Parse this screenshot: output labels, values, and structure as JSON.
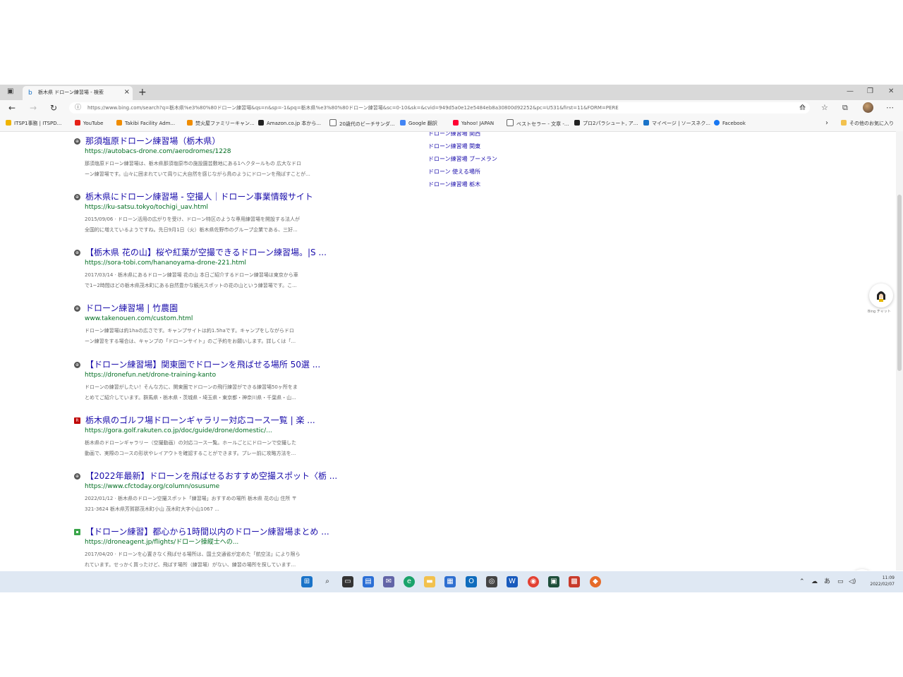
{
  "browser": {
    "tab_title": "栃木県 ドローン練習場 - 検索",
    "url": "https://www.bing.com/search?q=栃木県%e3%80%80ドローン練習場&qs=n&sp=-1&pq=栃木県%e3%80%80ドローン練習場&sc=0-10&sk=&cvid=949d5a0e12e5484eb8a30800d92252&pc=U531&first=11&FORM=PERE",
    "bookmarks": [
      {
        "label": "ITSP1事務 | ITSPD...",
        "color": "#f0b400"
      },
      {
        "label": "YouTube",
        "color": "#e62117"
      },
      {
        "label": "Takibi Facility Adm...",
        "color": "#f08c00"
      },
      {
        "label": "焚火屋ファミリーキャン...",
        "color": "#f08c00"
      },
      {
        "label": "Amazon.co.jp 本から...",
        "color": "#222222"
      },
      {
        "label": "20歳代のビーチサンダ...",
        "color": "#666666"
      },
      {
        "label": "Google 翻訳",
        "color": "#4285f4"
      },
      {
        "label": "Yahoo! JAPAN",
        "color": "#ff0033"
      },
      {
        "label": "ベストセラー - 文章 -...",
        "color": "#666666"
      },
      {
        "label": "プロ2パラシュート, ア...",
        "color": "#222222"
      },
      {
        "label": "マイページ | ソースネク...",
        "color": "#1a73c8"
      },
      {
        "label": "Facebook",
        "color": "#1877f2"
      }
    ],
    "other_favorites": "その他のお気に入り"
  },
  "results": [
    {
      "title": "那須塩原ドローン練習場（栃木県）",
      "url": "https://autobacs-drone.com/aerodromes/1228",
      "icon": "globe-icon",
      "snippet": [
        "那須塩原ドローン練習場は、栃木県那須塩原市の施設園芸敷地にある1ヘクタールもの 広大なドロ",
        "ーン練習場です。山々に囲まれていて周りに大自然を感じながら鳥のようにドローンを飛ばすことが..."
      ]
    },
    {
      "title": "栃木県にドローン練習場 - 空撮人｜ドローン事業情報サイト",
      "url": "https://ku-satsu.tokyo/tochigi_uav.html",
      "icon": "globe-icon",
      "snippet": [
        "2015/09/06 · ドローン活用の広がりを受け、ドローン特区のような専用練習場を開設する法人が",
        "全国的に増えているようですね。先日9月1日（火）栃木県佐野市のグループ企業である、三好..."
      ]
    },
    {
      "title": "【栃木県 花の山】桜や紅葉が空撮できるドローン練習場。|S ...",
      "url": "https://sora-tobi.com/hananoyama-drone-221.html",
      "icon": "globe-icon",
      "snippet": [
        "2017/03/14 · 栃木県にあるドローン練習場 花の山 本日ご紹介するドローン練習場は東京から車",
        "で1~2時間ほどの栃木県茂木町にある自然豊かな観光スポットの花の山という練習場です。こ..."
      ]
    },
    {
      "title": "ドローン練習場 | 竹農園",
      "url": "www.takenouen.com/custom.html",
      "icon": "globe-icon",
      "snippet": [
        "ドローン練習場は約1haの広さです。キャンプサイトは約1.5haです。キャンプをしながらドロ",
        "ーン練習をする場合は、キャンプの「ドローンサイト」のご予約をお願いします。詳しくは「..."
      ]
    },
    {
      "title": "【ドローン練習場】関東圏でドローンを飛ばせる場所 50選 ...",
      "url": "https://dronefun.net/drone-training-kanto",
      "icon": "globe-icon",
      "snippet": [
        "ドローンの練習がしたい！そんな方に、関東圏でドローンの飛行練習ができる練習場50ヶ所をま",
        "とめてご紹介しています。群馬県・栃木県・茨城県・埼玉県・東京都・神奈川県・千葉県・山..."
      ]
    },
    {
      "title": "栃木県のゴルフ場ドローンギャラリー対応コース一覧 | 楽 ...",
      "url": "https://gora.golf.rakuten.co.jp/doc/guide/drone/domestic/...",
      "icon": "rakuten-icon",
      "snippet": [
        "栃木県のドローンギャラリー（空撮動画）の対応コース一覧。ホールごとにドローンで空撮した",
        "動画で、実際のコースの形状やレイアウトを確認することができます。プレー前に攻略方法を..."
      ]
    },
    {
      "title": "【2022年最新】ドローンを飛ばせるおすすめ空撮スポット〈栃 ...",
      "url": "https://www.cfctoday.org/column/osusume",
      "icon": "globe-icon",
      "snippet": [
        "2022/01/12 · 栃木県のドローン空撮スポット「練習場」おすすめの場所 栃木県 花の山 住所 〒",
        "321-3624 栃木県芳賀郡茂木町小山 茂木町大字小山1067 ..."
      ]
    },
    {
      "title": "【ドローン練習】都心から1時間以内のドローン練習場まとめ ...",
      "url": "https://droneagent.jp/flights/ドローン操縦士への...",
      "icon": "droneagent-icon",
      "snippet": [
        "2017/04/20 · ドローンを心置きなく飛ばせる場所は、国土交通省が定めた「航空法」により限ら",
        "れています。せっかく買ったけど、飛ばす場所（練習場）がない、練習の場所を探しています..."
      ]
    }
  ],
  "related_searches": [
    "ドローン練習場 関西",
    "ドローン練習場 関東",
    "ドローン練習場 ブーメラン",
    "ドローン 使える場所",
    "ドローン練習場 栃木"
  ],
  "side_label": "Bing チャット",
  "clock": {
    "time": "11:09",
    "date": "2022/02/07"
  }
}
